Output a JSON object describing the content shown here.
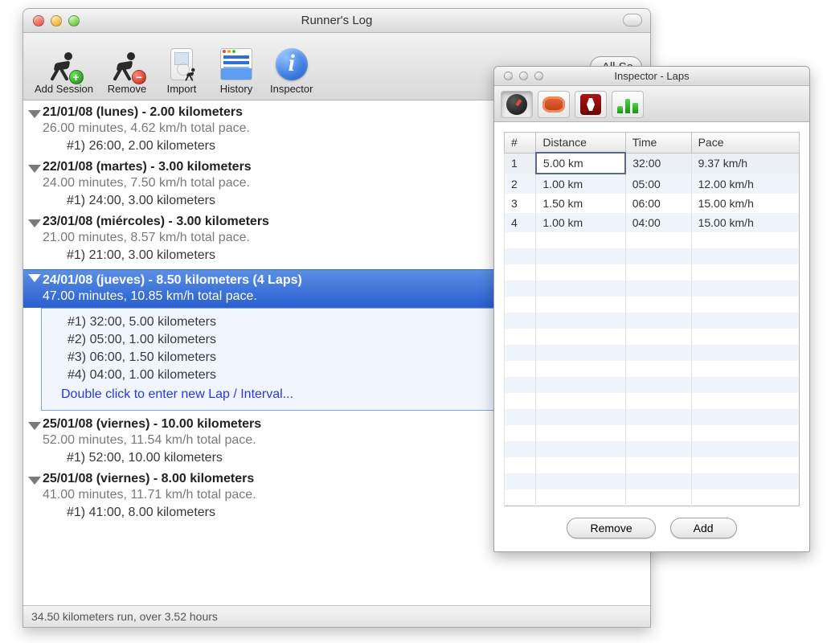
{
  "mainWindow": {
    "title": "Runner's Log",
    "toolbar": {
      "addSession": "Add Session",
      "remove": "Remove",
      "import": "Import",
      "history": "History",
      "inspector": "Inspector",
      "filterLabel": "All Se"
    },
    "sessions": [
      {
        "title": "21/01/08 (lunes) - 2.00 kilometers",
        "detail": "26.00 minutes, 4.62 km/h total pace.",
        "laps": [
          "#1) 26:00, 2.00 kilometers"
        ]
      },
      {
        "title": "22/01/08 (martes) - 3.00 kilometers",
        "detail": "24.00 minutes, 7.50 km/h total pace.",
        "laps": [
          "#1) 24:00, 3.00 kilometers"
        ]
      },
      {
        "title": "23/01/08 (miércoles) - 3.00 kilometers",
        "detail": "21.00 minutes, 8.57 km/h total pace.",
        "laps": [
          "#1) 21:00, 3.00 kilometers"
        ]
      },
      {
        "title": "24/01/08 (jueves) - 8.50 kilometers (4 Laps)",
        "detail": "47.00 minutes, 10.85 km/h total pace.",
        "laps": [
          "#1) 32:00, 5.00 kilometers",
          "#2) 05:00, 1.00 kilometers",
          "#3) 06:00, 1.50 kilometers",
          "#4) 04:00, 1.00 kilometers"
        ],
        "newLapPrompt": "Double click to enter new Lap / Interval..."
      },
      {
        "title": "25/01/08 (viernes) - 10.00 kilometers",
        "detail": "52.00 minutes, 11.54 km/h total pace.",
        "laps": [
          "#1) 52:00, 10.00 kilometers"
        ]
      },
      {
        "title": "25/01/08 (viernes) - 8.00 kilometers",
        "detail": "41.00 minutes, 11.71 km/h total pace.",
        "laps": [
          "#1) 41:00, 8.00 kilometers"
        ]
      }
    ],
    "status": "34.50 kilometers run, over 3.52 hours"
  },
  "inspector": {
    "title": "Inspector - Laps",
    "columns": {
      "num": "#",
      "distance": "Distance",
      "time": "Time",
      "pace": "Pace"
    },
    "rows": [
      {
        "num": "1",
        "distance": "5.00 km",
        "time": "32:00",
        "pace": "9.37 km/h"
      },
      {
        "num": "2",
        "distance": "1.00 km",
        "time": "05:00",
        "pace": "12.00 km/h"
      },
      {
        "num": "3",
        "distance": "1.50 km",
        "time": "06:00",
        "pace": "15.00 km/h"
      },
      {
        "num": "4",
        "distance": "1.00 km",
        "time": "04:00",
        "pace": "15.00 km/h"
      }
    ],
    "buttons": {
      "remove": "Remove",
      "add": "Add"
    }
  }
}
